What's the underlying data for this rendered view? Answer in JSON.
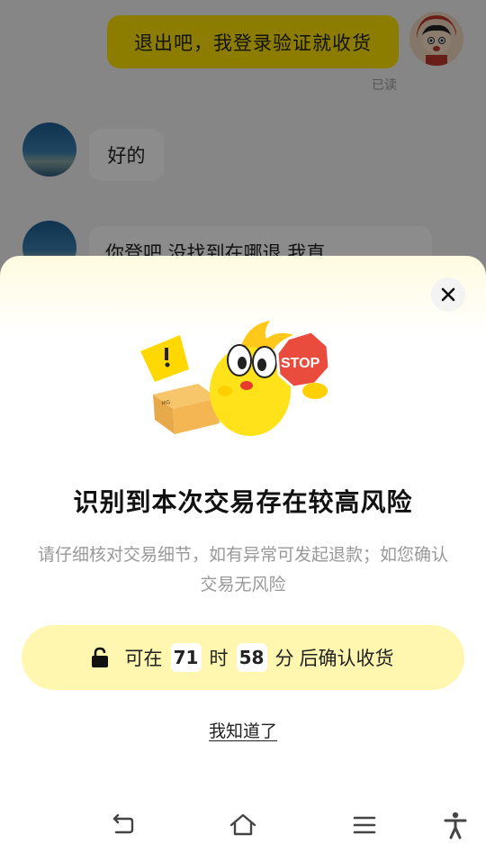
{
  "chat": {
    "outgoing_message": "退出吧，我登录验证就收货",
    "read_status": "已读",
    "incoming_message_1": "好的",
    "incoming_message_2": "你登吧 没找到在哪退          我直"
  },
  "risk_sheet": {
    "title": "识别到本次交易存在较高风险",
    "description": "请仔细核对交易细节，如有异常可发起退款；如您确认交易无风险",
    "mascot_sign_text": "STOP",
    "confirm_button": {
      "prefix": "可在",
      "hours": "71",
      "hours_unit": "时",
      "minutes": "58",
      "minutes_unit": "分",
      "suffix": "后确认收货",
      "icon": "lock-icon"
    },
    "ack_link": "我知道了",
    "close_icon": "close-icon"
  },
  "navbar": {
    "icons": [
      "back-icon",
      "home-icon",
      "menu-icon",
      "accessibility-icon"
    ]
  },
  "colors": {
    "accent_yellow": "#ffe400",
    "button_bg": "#fff6b0",
    "sheet_top": "#fffbe0"
  }
}
